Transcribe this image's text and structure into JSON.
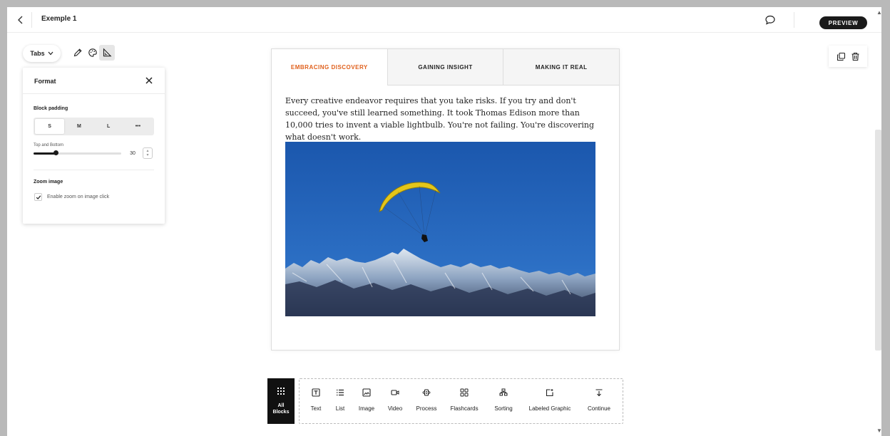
{
  "header": {
    "title": "Exemple 1",
    "preview_label": "PREVIEW"
  },
  "toolbar": {
    "block_type_label": "Tabs",
    "tools": [
      "pencil-icon",
      "palette-icon",
      "format-icon"
    ]
  },
  "format_panel": {
    "title": "Format",
    "block_padding_label": "Block padding",
    "padding_options": [
      "S",
      "M",
      "L",
      "•••"
    ],
    "padding_selected": "S",
    "top_bottom_label": "Top and Bottom",
    "top_bottom_value": "30",
    "slider_fraction": 0.25,
    "zoom_label": "Zoom image",
    "zoom_checkbox_label": "Enable zoom on image click",
    "zoom_checked": true
  },
  "block": {
    "tabs": [
      {
        "label": "EMBRACING DISCOVERY",
        "active": true
      },
      {
        "label": "GAINING INSIGHT",
        "active": false
      },
      {
        "label": "MAKING IT REAL",
        "active": false
      }
    ],
    "text": "Every creative endeavor requires that you take risks. If you try and don't succeed, you've still learned something. It took Thomas Edison more than 10,000 tries to invent a viable lightbulb. You're not failing. You're discovering what doesn't work."
  },
  "block_bar": {
    "all_blocks_label_1": "All",
    "all_blocks_label_2": "Blocks",
    "items": [
      {
        "label": "Text",
        "icon": "text-icon"
      },
      {
        "label": "List",
        "icon": "list-icon"
      },
      {
        "label": "Image",
        "icon": "image-icon"
      },
      {
        "label": "Video",
        "icon": "video-icon"
      },
      {
        "label": "Process",
        "icon": "process-icon"
      },
      {
        "label": "Flashcards",
        "icon": "flashcards-icon"
      },
      {
        "label": "Sorting",
        "icon": "sorting-icon"
      },
      {
        "label": "Labeled Graphic",
        "icon": "labeled-graphic-icon"
      },
      {
        "label": "Continue",
        "icon": "continue-icon"
      }
    ]
  },
  "colors": {
    "accent": "#e0601c",
    "dark": "#1a1a1a",
    "sky": "#1d5db4",
    "glider": "#e4c619"
  }
}
